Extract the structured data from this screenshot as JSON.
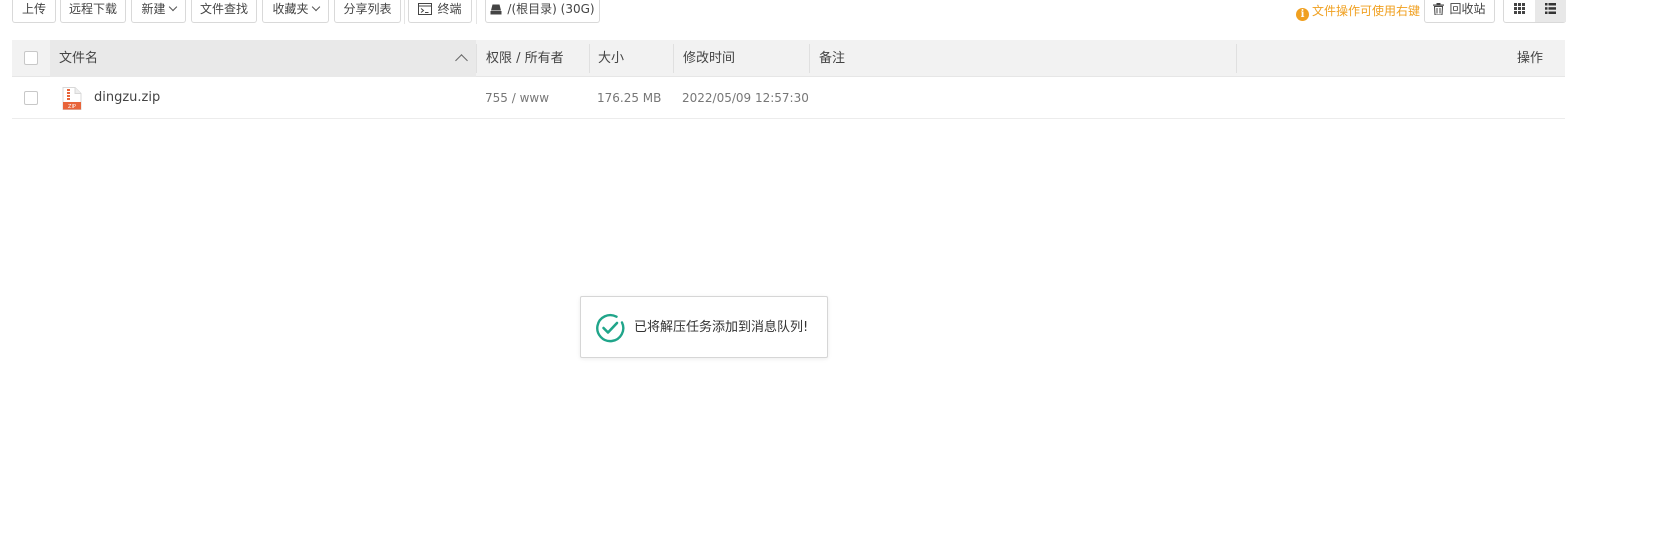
{
  "toolbar": {
    "upload": "上传",
    "remote_download": "远程下载",
    "new": "新建",
    "file_search": "文件查找",
    "favorites": "收藏夹",
    "share_list": "分享列表",
    "terminal": "终端",
    "disk": "/(根目录) (30G)"
  },
  "tip": "文件操作可使用右键",
  "recycle_bin": "回收站",
  "table": {
    "headers": {
      "name": "文件名",
      "permission_owner": "权限 / 所有者",
      "size": "大小",
      "modified": "修改时间",
      "remark": "备注",
      "actions": "操作"
    },
    "rows": [
      {
        "name": "dingzu.zip",
        "permission_owner": "755 / www",
        "size": "176.25 MB",
        "modified": "2022/05/09 12:57:30",
        "remark": "",
        "file_icon_label": "ZIP"
      }
    ]
  },
  "toast": {
    "message": "已将解压任务添加到消息队列!"
  },
  "colors": {
    "tip": "#f0a020",
    "success": "#20a58a",
    "zip_icon": "#e8643a"
  },
  "icons": {
    "tip": "info-icon",
    "terminal": "terminal-icon",
    "disk": "disk-icon",
    "recycle": "trash-icon",
    "grid_view": "grid-view-icon",
    "list_view": "list-view-icon",
    "sort": "chevron-up-icon",
    "toast": "check-circle-icon",
    "file": "zip-file-icon"
  }
}
